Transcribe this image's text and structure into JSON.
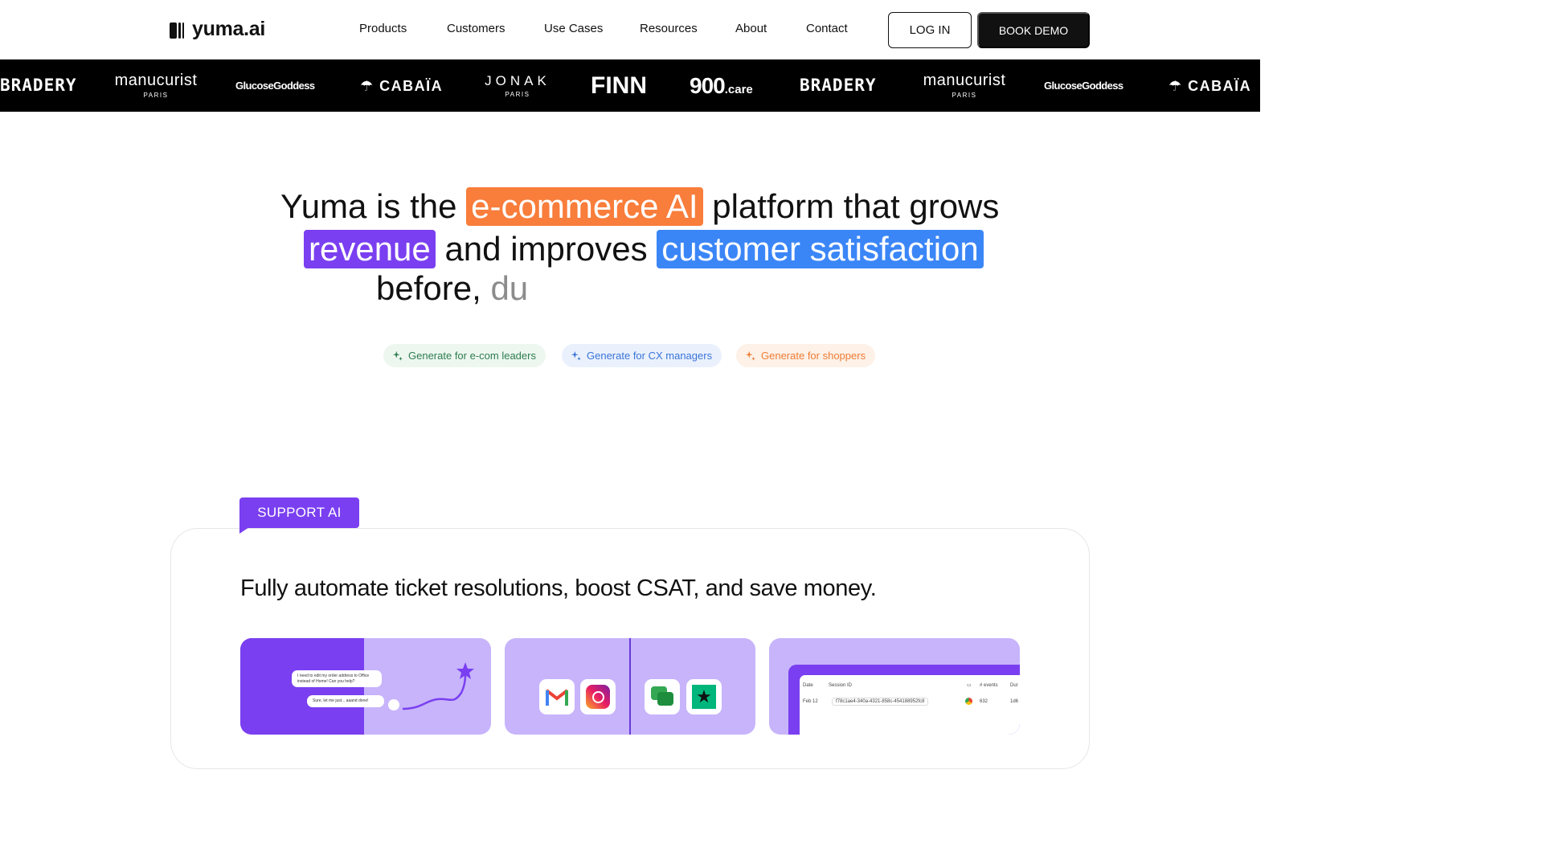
{
  "nav": {
    "logo_text": "yuma.ai",
    "menu": [
      "Products",
      "Customers",
      "Use Cases",
      "Resources",
      "About",
      "Contact"
    ],
    "login_label": "LOG IN",
    "demo_label": "BOOK DEMO"
  },
  "brands": [
    {
      "name": "BRADERY",
      "sub": ""
    },
    {
      "name": "manucurist",
      "sub": "PARIS"
    },
    {
      "name": "GlucoseGoddess",
      "sub": ""
    },
    {
      "name": "CABAÏA",
      "sub": ""
    },
    {
      "name": "JONAK",
      "sub": "PARIS"
    },
    {
      "name": "FINN",
      "sub": ""
    },
    {
      "name": "900",
      "sub": ".care"
    },
    {
      "name": "BRADERY",
      "sub": ""
    },
    {
      "name": "manucurist",
      "sub": "PARIS"
    },
    {
      "name": "GlucoseGoddess",
      "sub": ""
    },
    {
      "name": "CABAÏA",
      "sub": ""
    }
  ],
  "hero": {
    "part1": "Yuma is the",
    "highlight1": "e-commerce AI",
    "part2": "platform that grows",
    "highlight2": "revenue",
    "part3": "and improves",
    "highlight3": "customer satisfaction",
    "part4": "before,",
    "typed": "du"
  },
  "chips": [
    {
      "label": "Generate for e-com leaders",
      "color": "#2e7d4f"
    },
    {
      "label": "Generate for CX managers",
      "color": "#3a74d8"
    },
    {
      "label": "Generate for shoppers",
      "color": "#f07c34"
    }
  ],
  "support": {
    "tag": "SUPPORT AI",
    "title": "Fully automate ticket resolutions, boost CSAT, and save money.",
    "card1": {
      "bubble1": "I need to edit my order address to Office instead of Home! Can you help?",
      "bubble2": "Sure, let me just... aaand done!"
    },
    "card3": {
      "headers": [
        "Date",
        "Session ID",
        "# events",
        "Dur"
      ],
      "row": [
        "Feb 12",
        "f78c1ae4-340a-4321-858c-454188952fc8",
        "632",
        "1d6"
      ]
    }
  },
  "colors": {
    "accent_purple": "#7a3ff0",
    "accent_orange": "#f97d3b",
    "accent_blue": "#3b86f7"
  }
}
